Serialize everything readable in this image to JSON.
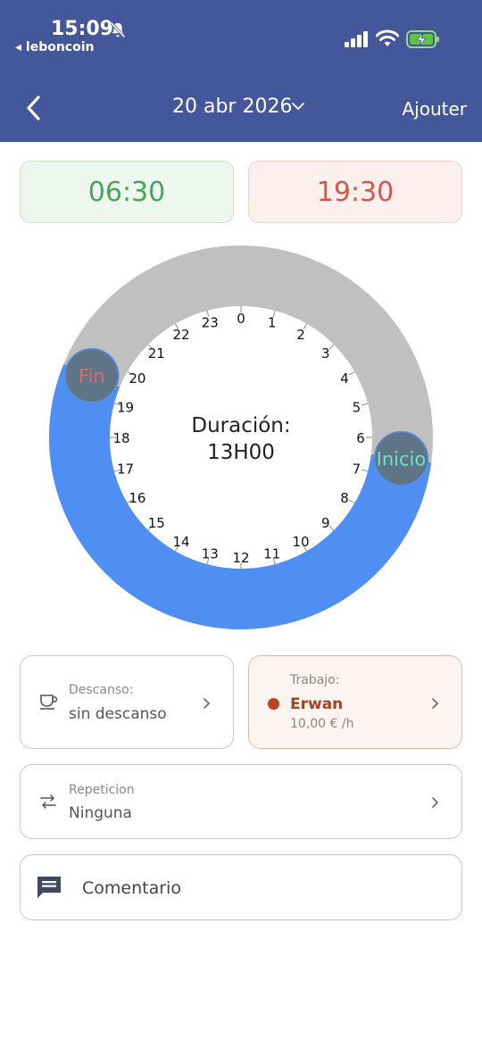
{
  "status_bar": {
    "time": "15:09",
    "back_app": "◂ leboncoin"
  },
  "nav": {
    "date": "20 abr 2026",
    "add_label": "Ajouter"
  },
  "times": {
    "start": "06:30",
    "end": "19:30"
  },
  "clock": {
    "duration_label": "Duración:",
    "duration_value": "13H00",
    "start_handle_label": "Inicio",
    "end_handle_label": "Fin",
    "hours": [
      "0",
      "1",
      "2",
      "3",
      "4",
      "5",
      "6",
      "7",
      "8",
      "9",
      "10",
      "11",
      "12",
      "13",
      "14",
      "15",
      "16",
      "17",
      "18",
      "19",
      "20",
      "21",
      "22",
      "23"
    ],
    "start_hour": 6.5,
    "end_hour": 19.5,
    "active_color": "#4f8ff3",
    "inactive_color": "#c0c0c0",
    "handle_color": "#5f7486"
  },
  "break_card": {
    "label": "Descanso:",
    "value": "sin descanso"
  },
  "work_card": {
    "label": "Trabajo:",
    "name": "Erwan",
    "rate": "10,00 € /h"
  },
  "repeat_card": {
    "label": "Repeticion",
    "value": "Ninguna"
  },
  "comment_card": {
    "label": "Comentario"
  },
  "colors": {
    "header": "#43579a",
    "start_green": "#4aa35a",
    "end_red": "#d4574b",
    "worker": "#b84524"
  }
}
